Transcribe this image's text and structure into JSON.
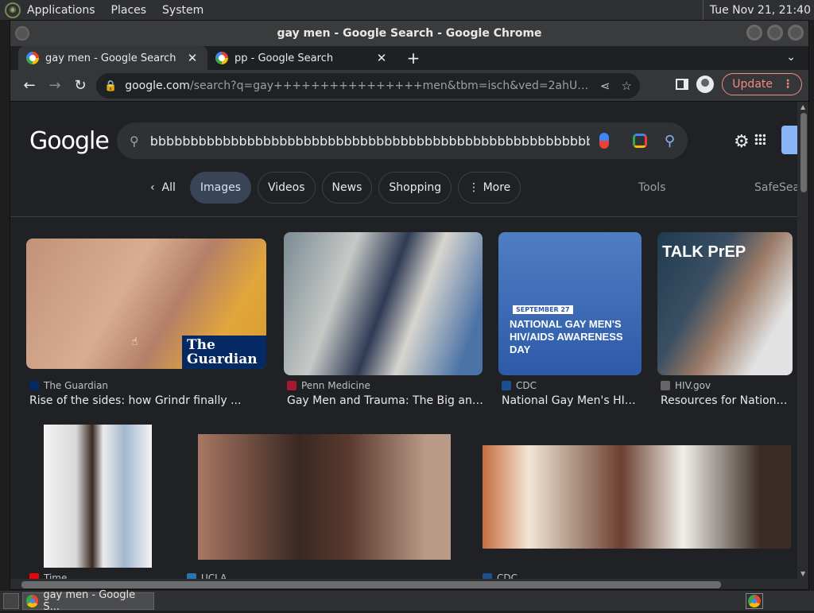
{
  "panel": {
    "menus": [
      "Applications",
      "Places",
      "System"
    ],
    "clock": "Tue Nov 21, 21:40"
  },
  "window": {
    "title": "gay men - Google Search - Google Chrome"
  },
  "tabs": [
    {
      "label": "gay men - Google Search",
      "active": true
    },
    {
      "label": "pp - Google Search",
      "active": false
    }
  ],
  "toolbar": {
    "url_domain": "google.com",
    "url_path": "/search?q=gay++++++++++++++++men&tbm=isch&ved=2ahUKEwij2vLAi9eCAxWRGmIA...",
    "update_label": "Update"
  },
  "search": {
    "query": "bbbbbbbbbbbbbbbbbbbbbbbbbbbbbbbbbbbbbbbbbbbbbbbbbbbbbbbbbbbbbbbbbbbbbbb"
  },
  "brand": {
    "logo_text": "Google",
    "accent": "#8ab4f8",
    "background": "#202124"
  },
  "filters": {
    "back": "All",
    "chips": [
      "Images",
      "Videos",
      "News",
      "Shopping",
      "More"
    ],
    "active": "Images",
    "tools": "Tools",
    "safesearch": "SafeSearch"
  },
  "results": [
    {
      "source": "The Guardian",
      "title": "Rise of the sides: how Grindr finally ...",
      "badge": "The Guardian"
    },
    {
      "source": "Penn Medicine",
      "title": "Gay Men and Trauma: The Big and Li..."
    },
    {
      "source": "CDC",
      "title": "National Gay Men's HIV/...",
      "date": "SEPTEMBER 27",
      "overlay": "NATIONAL GAY MEN'S HIV/AIDS AWARENESS DAY"
    },
    {
      "source": "HIV.gov",
      "title": "Resources for National ...",
      "overlay": "TALK PrEP"
    },
    {
      "source": "Time",
      "title": ""
    },
    {
      "source": "UCLA",
      "title": ""
    },
    {
      "source": "CDC",
      "title": ""
    }
  ],
  "taskbar": {
    "task_label": "gay men - Google S..."
  }
}
